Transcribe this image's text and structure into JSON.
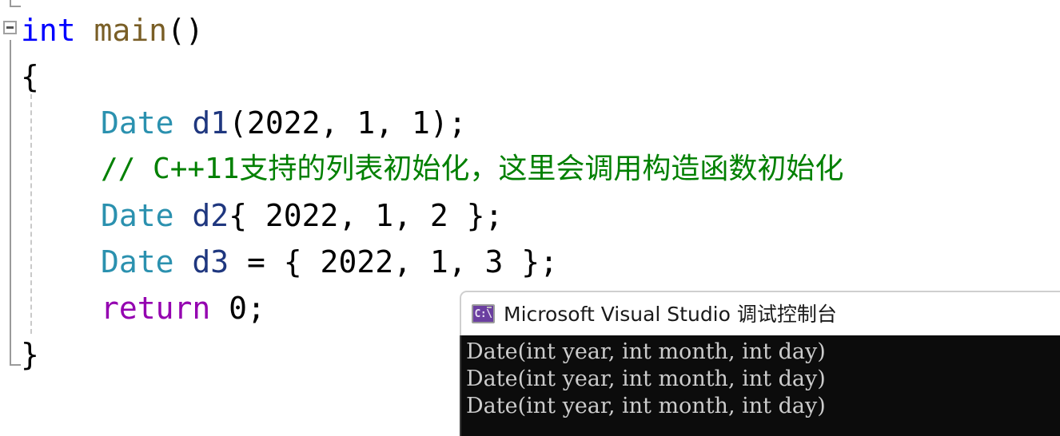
{
  "editor": {
    "name": "visual-studio-code-editor",
    "language": "cpp",
    "collapse_icon": "minus-box-icon",
    "lines": [
      {
        "id": "line-int-main",
        "indent": 0,
        "tokens": [
          {
            "text": "int",
            "type": "keyword"
          },
          {
            "text": " ",
            "type": "plain"
          },
          {
            "text": "main",
            "type": "function"
          },
          {
            "text": "()",
            "type": "plain"
          }
        ]
      },
      {
        "id": "line-open-brace",
        "indent": 1,
        "tokens": [
          {
            "text": "{",
            "type": "plain"
          }
        ]
      },
      {
        "id": "line-d1",
        "indent": 2,
        "tokens": [
          {
            "text": "Date",
            "type": "type"
          },
          {
            "text": " ",
            "type": "plain"
          },
          {
            "text": "d1",
            "type": "variable"
          },
          {
            "text": "(2022, 1, 1);",
            "type": "plain"
          }
        ]
      },
      {
        "id": "line-comment",
        "indent": 2,
        "tokens": [
          {
            "text": "// C++11支持的列表初始化，这里会调用构造函数初始化",
            "type": "comment"
          }
        ]
      },
      {
        "id": "line-d2",
        "indent": 2,
        "tokens": [
          {
            "text": "Date",
            "type": "type"
          },
          {
            "text": " ",
            "type": "plain"
          },
          {
            "text": "d2",
            "type": "variable"
          },
          {
            "text": "{ 2022, 1, 2 };",
            "type": "plain"
          }
        ]
      },
      {
        "id": "line-d3",
        "indent": 2,
        "tokens": [
          {
            "text": "Date",
            "type": "type"
          },
          {
            "text": " ",
            "type": "plain"
          },
          {
            "text": "d3",
            "type": "variable"
          },
          {
            "text": " = { 2022, 1, 3 };",
            "type": "plain"
          }
        ]
      },
      {
        "id": "line-return",
        "indent": 2,
        "tokens": [
          {
            "text": "return",
            "type": "control"
          },
          {
            "text": " ",
            "type": "plain"
          },
          {
            "text": "0",
            "type": "number"
          },
          {
            "text": ";",
            "type": "plain"
          }
        ]
      },
      {
        "id": "line-close-brace",
        "indent": 1,
        "tokens": [
          {
            "text": "}",
            "type": "plain"
          }
        ]
      }
    ],
    "colors": {
      "keyword": "#0000ff",
      "function": "#795e26",
      "type": "#2b91af",
      "variable": "#1f377f",
      "comment": "#008000",
      "control": "#9400b0",
      "plain": "#000000",
      "background": "#ffffff",
      "gutter_line": "#9a9a9a",
      "indent_guide": "#c9c9c9"
    }
  },
  "console": {
    "window_name": "debug-console-window",
    "icon": "console-cmd-icon",
    "icon_text": "C:\\",
    "title": "Microsoft Visual Studio 调试控制台",
    "output_lines": [
      "Date(int year, int month, int day)",
      "Date(int year, int month, int day)",
      "Date(int year, int month, int day)"
    ],
    "colors": {
      "titlebar_background": "#ffffff",
      "body_background": "#0c0c0c",
      "text": "#cccccc",
      "icon_background": "#6b3fa0"
    }
  }
}
